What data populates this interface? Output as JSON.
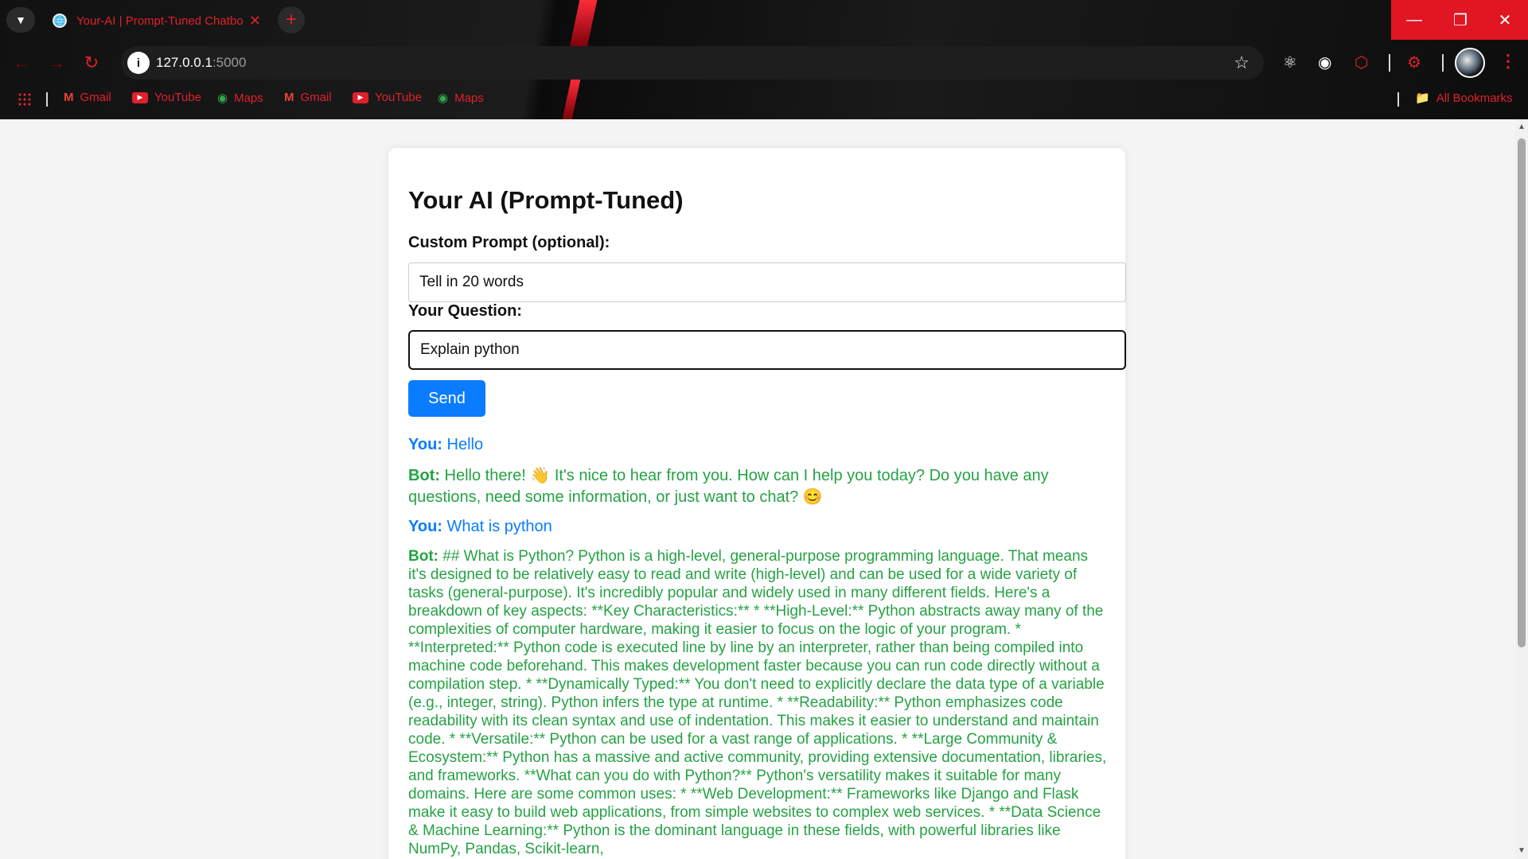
{
  "browser": {
    "tab_title": "Your-AI | Prompt-Tuned Chatbot",
    "new_tab": "+",
    "url_host": "127.0.0.1",
    "url_port": ":5000",
    "bookmarks": [
      "Gmail",
      "YouTube",
      "Maps",
      "Gmail",
      "YouTube",
      "Maps"
    ],
    "all_bookmarks": "All Bookmarks",
    "accent": "#e0202c"
  },
  "page": {
    "title": "Your AI (Prompt-Tuned)",
    "prompt_label": "Custom Prompt (optional):",
    "prompt_value": "Tell in 20 words",
    "question_label": "Your Question:",
    "question_value": "Explain python",
    "send_label": "Send"
  },
  "chat": [
    {
      "speaker": "You:",
      "text": "Hello"
    },
    {
      "speaker": "Bot:",
      "text": "Hello there! 👋 It's nice to hear from you. How can I help you today? Do you have any questions, need some information, or just want to chat? 😊"
    },
    {
      "speaker": "You:",
      "text": "What is python"
    },
    {
      "speaker": "Bot:",
      "text": "## What is Python? Python is a high-level, general-purpose programming language. That means it's designed to be relatively easy to read and write (high-level) and can be used for a wide variety of tasks (general-purpose). It's incredibly popular and widely used in many different fields. Here's a breakdown of key aspects: **Key Characteristics:** * **High-Level:** Python abstracts away many of the complexities of computer hardware, making it easier to focus on the logic of your program. * **Interpreted:** Python code is executed line by line by an interpreter, rather than being compiled into machine code beforehand. This makes development faster because you can run code directly without a compilation step. * **Dynamically Typed:** You don't need to explicitly declare the data type of a variable (e.g., integer, string). Python infers the type at runtime. * **Readability:** Python emphasizes code readability with its clean syntax and use of indentation. This makes it easier to understand and maintain code. * **Versatile:** Python can be used for a vast range of applications. * **Large Community & Ecosystem:** Python has a massive and active community, providing extensive documentation, libraries, and frameworks. **What can you do with Python?** Python's versatility makes it suitable for many domains. Here are some common uses: * **Web Development:** Frameworks like Django and Flask make it easy to build web applications, from simple websites to complex web services. * **Data Science & Machine Learning:** Python is the dominant language in these fields, with powerful libraries like NumPy, Pandas, Scikit-learn,"
    }
  ]
}
